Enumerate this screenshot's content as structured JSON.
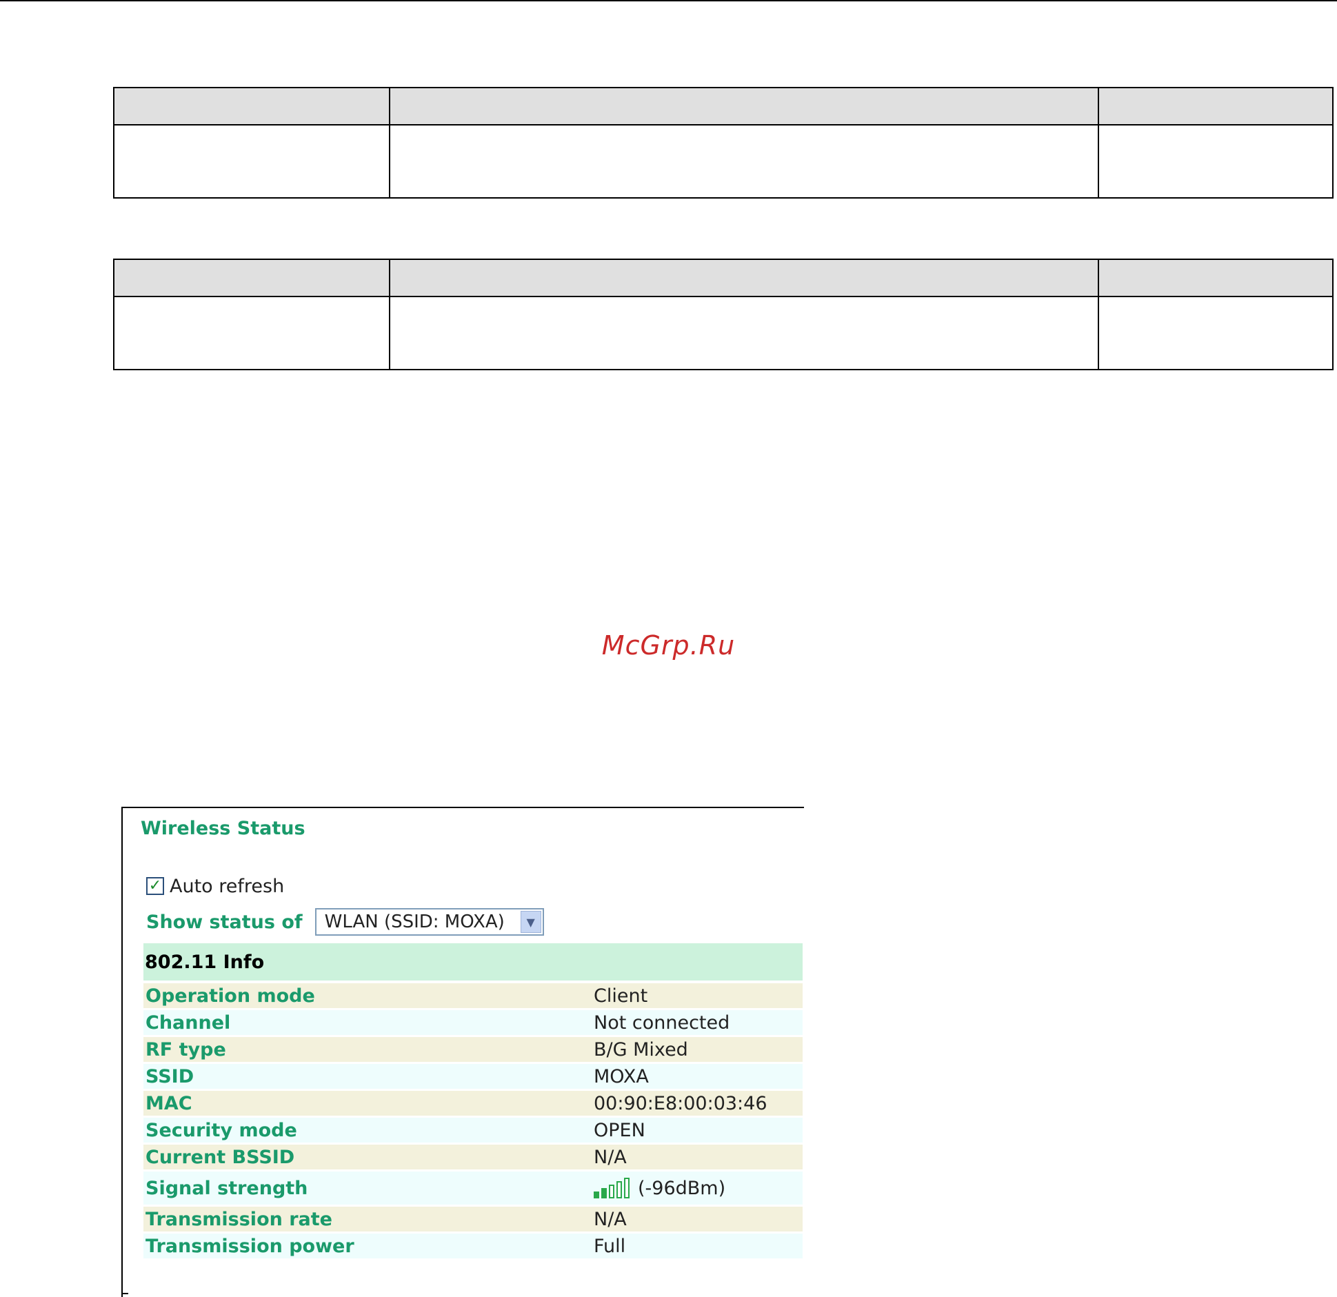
{
  "watermark": "McGrp.Ru",
  "doc_tables": [
    {
      "header": [
        "",
        "",
        ""
      ],
      "row": [
        "",
        "",
        ""
      ]
    },
    {
      "header": [
        "",
        "",
        ""
      ],
      "row": [
        "",
        "",
        ""
      ]
    }
  ],
  "wireless_status": {
    "title": "Wireless Status",
    "auto_refresh": {
      "label": "Auto refresh",
      "checked": true,
      "check_glyph": "✓"
    },
    "show_status": {
      "label": "Show status of",
      "selected": "WLAN (SSID: MOXA)",
      "arrow_glyph": "▼"
    },
    "section_title": "802.11 Info",
    "rows": [
      {
        "key": "Operation mode",
        "value": "Client"
      },
      {
        "key": "Channel",
        "value": "Not connected"
      },
      {
        "key": "RF type",
        "value": "B/G Mixed"
      },
      {
        "key": "SSID",
        "value": "MOXA"
      },
      {
        "key": "MAC",
        "value": "00:90:E8:00:03:46"
      },
      {
        "key": "Security mode",
        "value": "OPEN"
      },
      {
        "key": "Current BSSID",
        "value": "N/A"
      },
      {
        "key": "Signal strength",
        "value": "(-96dBm)",
        "signal_level": 2,
        "signal_max": 5
      },
      {
        "key": "Transmission rate",
        "value": "N/A"
      },
      {
        "key": "Transmission power",
        "value": "Full"
      }
    ]
  },
  "colors": {
    "label_green": "#1a9a6b",
    "header_green": "#ccf2dc",
    "row_odd": "#f3f1dc",
    "row_even": "#eefdfd",
    "watermark_red": "#cc2a2a",
    "table_header_gray": "#e0e0e0"
  },
  "icons": {
    "signal": "signal-strength-icon",
    "check": "checkmark-icon",
    "dropdown": "chevron-down-icon"
  }
}
